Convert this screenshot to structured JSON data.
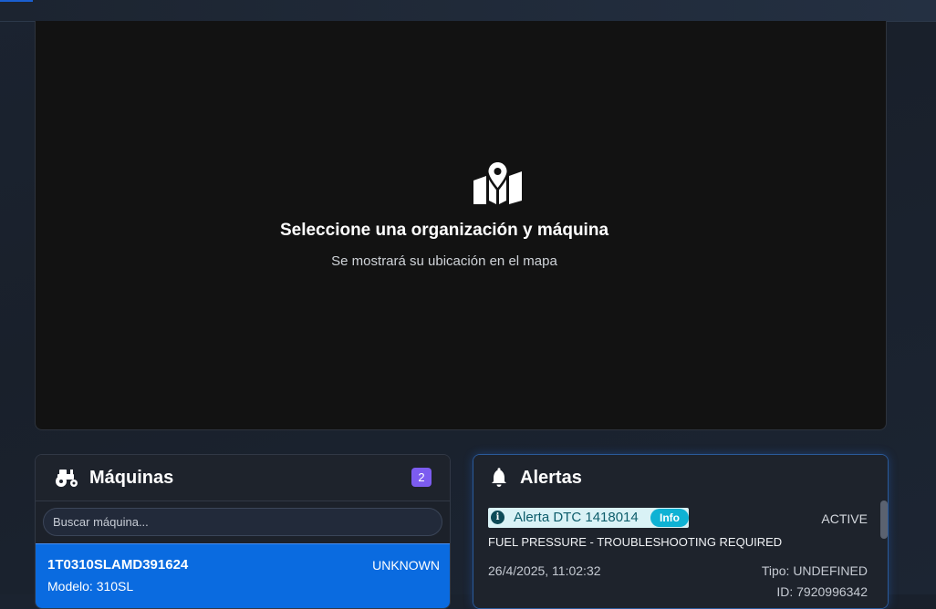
{
  "map": {
    "title": "Seleccione una organización y máquina",
    "subtitle": "Se mostrará su ubicación en el mapa",
    "icon": "map-location-icon"
  },
  "machines": {
    "title": "Máquinas",
    "count": "2",
    "icon": "tractor-icon",
    "search_placeholder": "Buscar máquina...",
    "items": [
      {
        "id": "1T0310SLAMD391624",
        "status": "UNKNOWN",
        "model": "Modelo: 310SL"
      }
    ]
  },
  "alerts": {
    "title": "Alertas",
    "icon": "bell-icon",
    "items": [
      {
        "name": "Alerta DTC 1418014",
        "severity": "Info",
        "state": "ACTIVE",
        "description": "FUEL PRESSURE - TROUBLESHOOTING REQUIRED",
        "date": "26/4/2025, 11:02:32",
        "type": "Tipo: UNDEFINED",
        "id": "ID: 7920996342"
      }
    ]
  },
  "colors": {
    "accent": "#0a6be0",
    "badge": "#7c5cf0",
    "info": "#0fb2d4"
  }
}
